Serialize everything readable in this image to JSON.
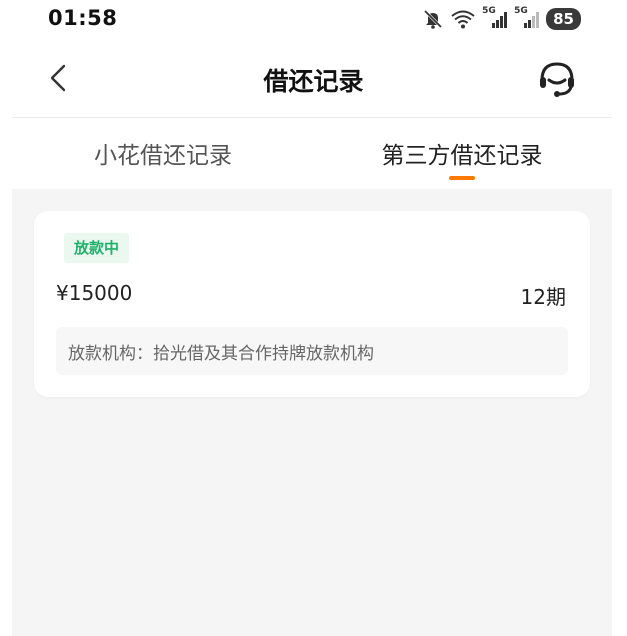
{
  "status_bar": {
    "time": "01:58",
    "battery": "85",
    "network_5g_a": "5G",
    "network_5g_b": "5G"
  },
  "nav": {
    "title": "借还记录"
  },
  "tabs": [
    {
      "label": "小花借还记录",
      "active": false
    },
    {
      "label": "第三方借还记录",
      "active": true
    }
  ],
  "colors": {
    "accent": "#ff7a00",
    "badge_text": "#20b26b",
    "badge_bg": "#eaf8f0",
    "content_bg": "#f5f5f5"
  },
  "records": [
    {
      "status": "放款中",
      "amount": "¥15000",
      "periods": "12期",
      "institution": "放款机构：拾光借及其合作持牌放款机构"
    }
  ],
  "icons": {
    "back": "chevron-left-icon",
    "service": "headset-icon",
    "mute": "bell-mute-icon",
    "wifi": "wifi-icon",
    "signal": "signal-icon"
  }
}
